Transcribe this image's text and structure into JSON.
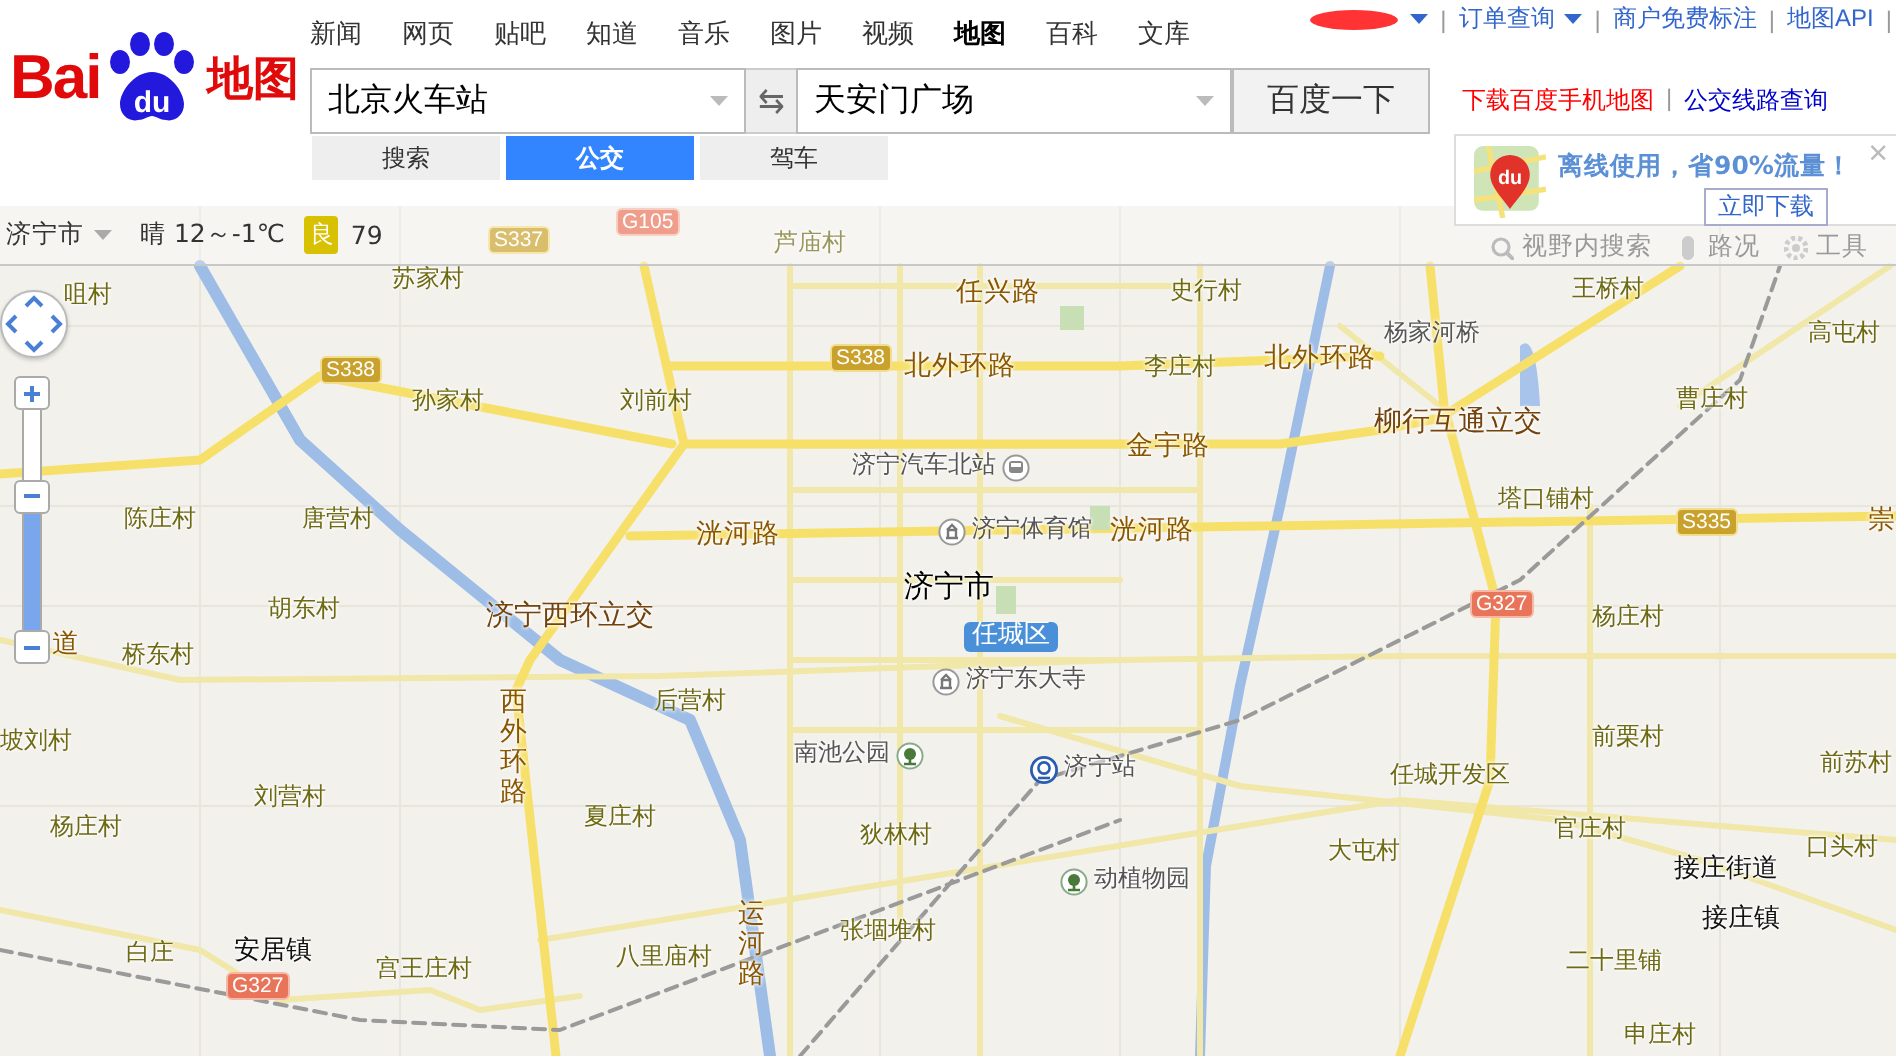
{
  "logo": {
    "left": "Bai",
    "paw": "du",
    "right": "地图"
  },
  "nav": [
    {
      "label": "新闻",
      "selected": false
    },
    {
      "label": "网页",
      "selected": false
    },
    {
      "label": "贴吧",
      "selected": false
    },
    {
      "label": "知道",
      "selected": false
    },
    {
      "label": "音乐",
      "selected": false
    },
    {
      "label": "图片",
      "selected": false
    },
    {
      "label": "视频",
      "selected": false
    },
    {
      "label": "地图",
      "selected": true
    },
    {
      "label": "百科",
      "selected": false
    },
    {
      "label": "文库",
      "selected": false
    }
  ],
  "account_links": [
    {
      "label": "订单查询",
      "dropdown": true
    },
    {
      "label": "商户免费标注",
      "dropdown": false
    },
    {
      "label": "地图API",
      "dropdown": false
    }
  ],
  "account_separator": "|",
  "route_search": {
    "from": "北京火车站",
    "to": "天安门广场",
    "swap": "⇆",
    "button": "百度一下"
  },
  "modes": [
    {
      "label": "搜索",
      "selected": false
    },
    {
      "label": "公交",
      "selected": true
    },
    {
      "label": "驾车",
      "selected": false
    }
  ],
  "side_separator": "|",
  "side_links": [
    {
      "label": "下载百度手机地图",
      "kind": "promo"
    },
    {
      "label": "公交线路查询",
      "kind": "link"
    }
  ],
  "toolbar": {
    "city": "济宁市",
    "weather": "晴 12～-1℃",
    "aqi_badge": "良",
    "aqi": "79",
    "tools": [
      "视野内搜索",
      "路况",
      "工具"
    ]
  },
  "popup": {
    "app_icon_text": "du",
    "message": "离线使用，省90%流量！",
    "button": "立即下载",
    "close": "×"
  },
  "map": {
    "zoom": {
      "level": 0.61
    },
    "labels": [
      {
        "text": "G105",
        "kind": "national"
      },
      {
        "text": "S337",
        "kind": "provincial"
      },
      {
        "text": "芦庙村",
        "kind": "village"
      },
      {
        "text": "苏家村",
        "kind": "village"
      },
      {
        "text": "咀村",
        "kind": "village"
      },
      {
        "text": "任兴路",
        "kind": "road"
      },
      {
        "text": "史行村",
        "kind": "village"
      },
      {
        "text": "王桥村",
        "kind": "village"
      },
      {
        "text": "杨家河桥",
        "kind": "poi"
      },
      {
        "text": "高屯村",
        "kind": "village"
      },
      {
        "text": "S338",
        "kind": "provincial"
      },
      {
        "text": "S338",
        "kind": "provincial"
      },
      {
        "text": "北外环路",
        "kind": "road"
      },
      {
        "text": "李庄村",
        "kind": "village"
      },
      {
        "text": "北外环路",
        "kind": "road"
      },
      {
        "text": "孙家村",
        "kind": "village"
      },
      {
        "text": "刘前村",
        "kind": "village"
      },
      {
        "text": "曹庄村",
        "kind": "village"
      },
      {
        "text": "柳行互通立交",
        "kind": "junction"
      },
      {
        "text": "金宇路",
        "kind": "road"
      },
      {
        "text": "济宁汽车北站",
        "kind": "poi"
      },
      {
        "text": "塔口铺村",
        "kind": "village"
      },
      {
        "text": "陈庄村",
        "kind": "village"
      },
      {
        "text": "唐营村",
        "kind": "village"
      },
      {
        "text": "洸河路",
        "kind": "road"
      },
      {
        "text": "济宁体育馆",
        "kind": "poi"
      },
      {
        "text": "洸河路",
        "kind": "road"
      },
      {
        "text": "S335",
        "kind": "provincial"
      },
      {
        "text": "崇",
        "kind": "road"
      },
      {
        "text": "济宁市",
        "kind": "city"
      },
      {
        "text": "胡东村",
        "kind": "village"
      },
      {
        "text": "济宁西环立交",
        "kind": "junction"
      },
      {
        "text": "G327",
        "kind": "national"
      },
      {
        "text": "杨庄村",
        "kind": "village"
      },
      {
        "text": "任城区",
        "kind": "district"
      },
      {
        "text": "道",
        "kind": "road"
      },
      {
        "text": "桥东村",
        "kind": "village"
      },
      {
        "text": "济宁东大寺",
        "kind": "poi"
      },
      {
        "text": "坡刘村",
        "kind": "village"
      },
      {
        "text": "西外环路",
        "kind": "road_vertical"
      },
      {
        "text": "后营村",
        "kind": "village"
      },
      {
        "text": "前栗村",
        "kind": "village"
      },
      {
        "text": "南池公园",
        "kind": "poi"
      },
      {
        "text": "济宁站",
        "kind": "poi"
      },
      {
        "text": "前苏村",
        "kind": "village"
      },
      {
        "text": "任城开发区",
        "kind": "village"
      },
      {
        "text": "刘营村",
        "kind": "village"
      },
      {
        "text": "夏庄村",
        "kind": "village"
      },
      {
        "text": "杨庄村",
        "kind": "village"
      },
      {
        "text": "狄林村",
        "kind": "village"
      },
      {
        "text": "官庄村",
        "kind": "village"
      },
      {
        "text": "口头村",
        "kind": "village"
      },
      {
        "text": "大屯村",
        "kind": "village"
      },
      {
        "text": "动植物园",
        "kind": "poi"
      },
      {
        "text": "接庄街道",
        "kind": "town"
      },
      {
        "text": "白庄",
        "kind": "village"
      },
      {
        "text": "安居镇",
        "kind": "town"
      },
      {
        "text": "G327",
        "kind": "national"
      },
      {
        "text": "宫王庄村",
        "kind": "village"
      },
      {
        "text": "八里庙村",
        "kind": "village"
      },
      {
        "text": "运河路",
        "kind": "road_vertical"
      },
      {
        "text": "张堌堆村",
        "kind": "village"
      },
      {
        "text": "接庄镇",
        "kind": "town"
      },
      {
        "text": "二十里铺",
        "kind": "village"
      },
      {
        "text": "申庄村",
        "kind": "village"
      }
    ]
  }
}
